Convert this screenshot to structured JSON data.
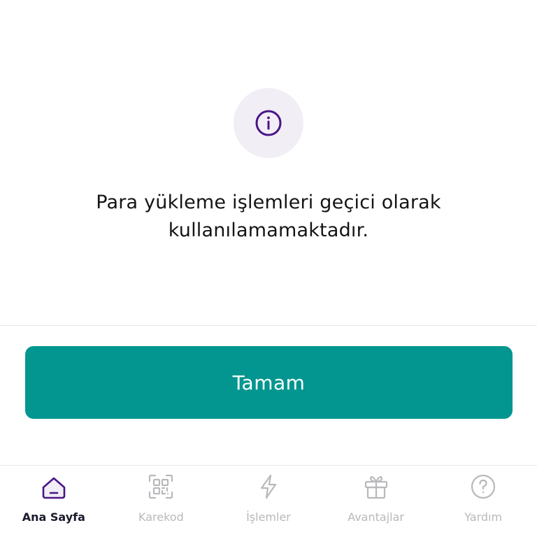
{
  "dialog": {
    "icon": "info-icon",
    "message": "Para yükleme işlemleri geçici olarak kullanılamamaktadır.",
    "confirm_label": "Tamam"
  },
  "colors": {
    "primary": "#039690",
    "accent_purple": "#4a1585",
    "icon_bg": "#f1eef6",
    "nav_inactive": "#b9b9bd"
  },
  "bottom_nav": {
    "items": [
      {
        "label": "Ana Sayfa",
        "icon": "home-icon",
        "active": true
      },
      {
        "label": "Karekod",
        "icon": "qr-code-icon",
        "active": false
      },
      {
        "label": "İşlemler",
        "icon": "lightning-icon",
        "active": false
      },
      {
        "label": "Avantajlar",
        "icon": "gift-icon",
        "active": false
      },
      {
        "label": "Yardım",
        "icon": "help-icon",
        "active": false
      }
    ]
  }
}
